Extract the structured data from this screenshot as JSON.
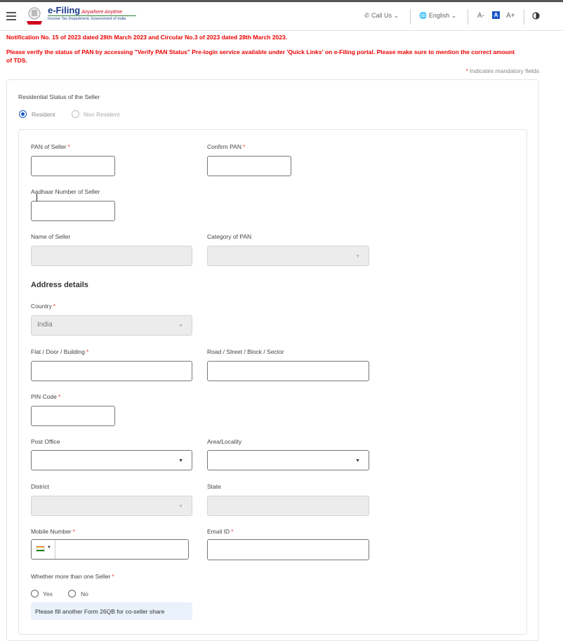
{
  "header": {
    "brand": "e-Filing",
    "brand_tag": "Anywhere Anytime",
    "brand_sub": "Income Tax Department, Government of India",
    "call_us": "Call Us",
    "language": "English",
    "font_decrease": "A-",
    "font_normal": "A",
    "font_increase": "A+",
    "contrast_icon": "half-circle-icon"
  },
  "notices": {
    "line1": "Notification No. 15 of 2023 dated 28th March 2023 and Circular No.3 of 2023 dated 28th March 2023.",
    "line2": "Please verify the status of PAN by accessing \"Verify PAN Status\" Pre-login service available under 'Quick Links' on e-Filing portal. Please make sure to mention the correct amount",
    "line3": "of TDS.",
    "mandatory_star": "*",
    "mandatory_text": "Indicates mandatory fields"
  },
  "form": {
    "residential_status_label": "Residential Status of the Seller",
    "resident": "Resident",
    "non_resident": "Non Resident",
    "pan_label": "PAN of Seller",
    "confirm_pan_label": "Confirm PAN",
    "aadhaar_label": "Aadhaar Number of Seller",
    "name_label": "Name of Seller",
    "category_label": "Category of PAN",
    "address_heading": "Address details",
    "country_label": "Country",
    "country_value": "India",
    "flat_label": "Flat / Door / Building",
    "road_label": "Road / Street / Block / Sector",
    "pin_label": "PIN Code",
    "post_office_label": "Post Office",
    "area_label": "Area/Locality",
    "district_label": "District",
    "state_label": "State",
    "mobile_label": "Mobile Number",
    "email_label": "Email ID",
    "more_sellers_label": "Whether more than one Seller",
    "yes": "Yes",
    "no": "No",
    "info_text": "Please fill another Form 26QB for co-seller share",
    "star": "*"
  },
  "colors": {
    "notice_red": "#ee0000",
    "accent_blue": "#1a56c8",
    "brand_blue": "#1b3a8a"
  }
}
